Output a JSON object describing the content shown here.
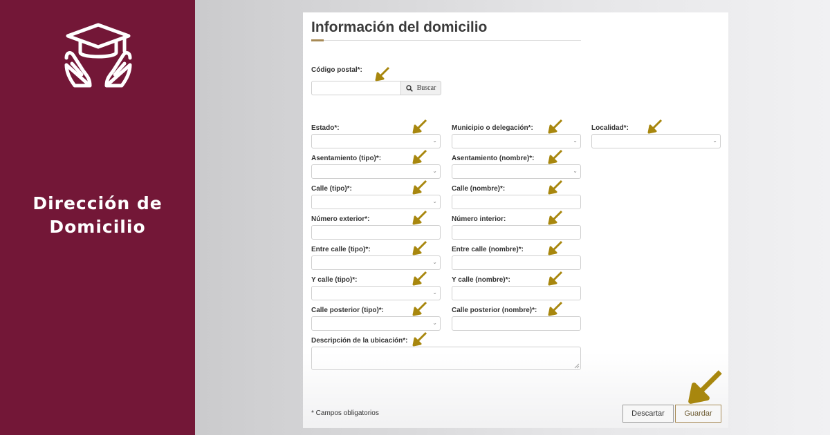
{
  "sidebar": {
    "logo_icon": "graduation-cap-hands-icon",
    "title_line1": "Dirección de",
    "title_line2": "Domicilio",
    "background_color": "#731737"
  },
  "form": {
    "title": "Información del domicilio",
    "accent_color": "#a78a55",
    "arrow_color": "#a8870e",
    "postal_code": {
      "label": "Código postal*:",
      "value": "",
      "search_icon": "search-icon",
      "search_label": "Buscar"
    },
    "fields": {
      "estado": {
        "label": "Estado*:"
      },
      "municipio": {
        "label": "Municipio o delegación*:"
      },
      "localidad": {
        "label": "Localidad*:"
      },
      "asentamiento_tipo": {
        "label": "Asentamiento (tipo)*:"
      },
      "asentamiento_nombre": {
        "label": "Asentamiento (nombre)*:"
      },
      "calle_tipo": {
        "label": "Calle (tipo)*:"
      },
      "calle_nombre": {
        "label": "Calle (nombre)*:"
      },
      "numero_exterior": {
        "label": "Número exterior*:"
      },
      "numero_interior": {
        "label": "Número interior:"
      },
      "entre_calle_tipo": {
        "label": "Entre calle (tipo)*:"
      },
      "entre_calle_nombre": {
        "label": "Entre calle (nombre)*:"
      },
      "y_calle_tipo": {
        "label": "Y calle (tipo)*:"
      },
      "y_calle_nombre": {
        "label": "Y calle (nombre)*:"
      },
      "calle_posterior_tipo": {
        "label": "Calle posterior (tipo)*:"
      },
      "calle_posterior_nombre": {
        "label": "Calle posterior (nombre)*:"
      },
      "descripcion": {
        "label": "Descripción de la ubicación*:"
      }
    },
    "required_note": "* Campos obligatorios",
    "buttons": {
      "discard_label": "Descartar",
      "save_label": "Guardar"
    }
  }
}
